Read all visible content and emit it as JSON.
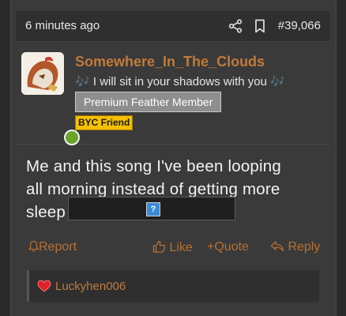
{
  "post": {
    "timestamp": "6 minutes ago",
    "post_number": "#39,066"
  },
  "author": {
    "username": "Somewhere_In_The_Clouds",
    "tagline_prefix": "🎶",
    "tagline_text": "I will sit in your shadows with you",
    "tagline_suffix": "🎶",
    "badge": "Premium Feather Member",
    "byc_badge": "BYC Friend"
  },
  "message": {
    "line1": "Me and this song I've been looping",
    "line2": "all morning instead of getting more",
    "line3": "sleep",
    "embed_placeholder": "?"
  },
  "actions": {
    "report": "Report",
    "like": "Like",
    "quote": "+Quote",
    "reply": "Reply"
  },
  "reactions": {
    "user": "Luckyhen006"
  },
  "colors": {
    "accent": "#c07a3a",
    "online": "#6aa52b",
    "byc": "#f5c000"
  }
}
